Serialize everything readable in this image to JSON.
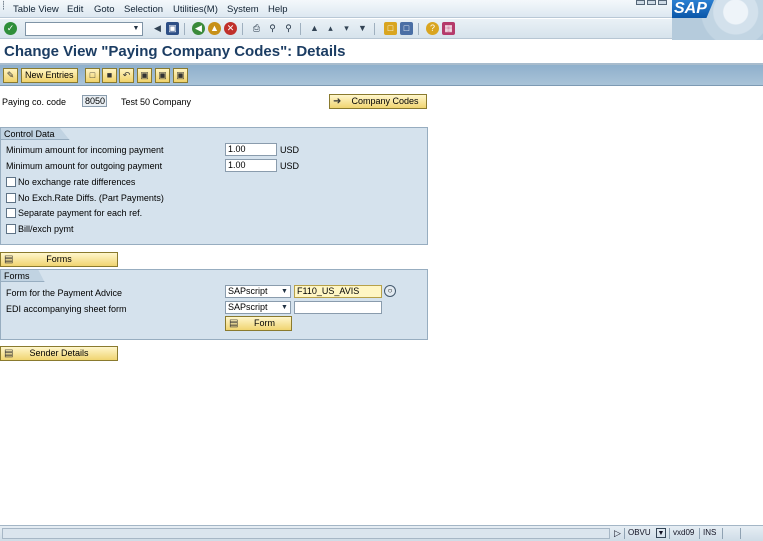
{
  "menu": {
    "items": [
      "Table View",
      "Edit",
      "Goto",
      "Selection",
      "Utilities(M)",
      "System",
      "Help"
    ]
  },
  "logo": {
    "text": "SAP"
  },
  "toolbar": {
    "okcode_value": "",
    "icons": [
      "enter-icon",
      "back-arrow-icon",
      "save-icon",
      "back-icon",
      "exit-icon",
      "cancel-icon",
      "print-icon",
      "find-icon",
      "find-next-icon",
      "first-page-icon",
      "previous-page-icon",
      "next-page-icon",
      "last-page-icon",
      "create-session-icon",
      "shortcut-icon",
      "help-icon",
      "layout-icon"
    ]
  },
  "title": "Change View \"Paying Company Codes\": Details",
  "app_toolbar": {
    "new_entries_label": "New Entries"
  },
  "header": {
    "paying_code_label": "Paying co. code",
    "paying_code_value": "8050",
    "company_name": "Test 50 Company",
    "company_codes_button": "Company Codes"
  },
  "control_data": {
    "title": "Control Data",
    "min_incoming_label": "Minimum amount for incoming payment",
    "min_incoming_value": "1.00",
    "min_incoming_currency": "USD",
    "min_outgoing_label": "Minimum amount for outgoing payment",
    "min_outgoing_value": "1.00",
    "min_outgoing_currency": "USD",
    "checkboxes": [
      {
        "label": "No exchange rate differences",
        "checked": false
      },
      {
        "label": "No Exch.Rate Diffs. (Part Payments)",
        "checked": false
      },
      {
        "label": "Separate payment for each ref.",
        "checked": false
      },
      {
        "label": "Bill/exch pymt",
        "checked": false
      }
    ]
  },
  "forms_button": "Forms",
  "forms": {
    "title": "Forms",
    "payment_advice_label": "Form for the Payment Advice",
    "payment_advice_type": "SAPscript",
    "payment_advice_value": "F110_US_AVIS",
    "edi_label": "EDI accompanying sheet form",
    "edi_type": "SAPscript",
    "edi_value": "",
    "form_button": "Form"
  },
  "sender_details_button": "Sender Details",
  "status": {
    "system": "OBVU",
    "server": "vxd09",
    "mode": "INS"
  }
}
